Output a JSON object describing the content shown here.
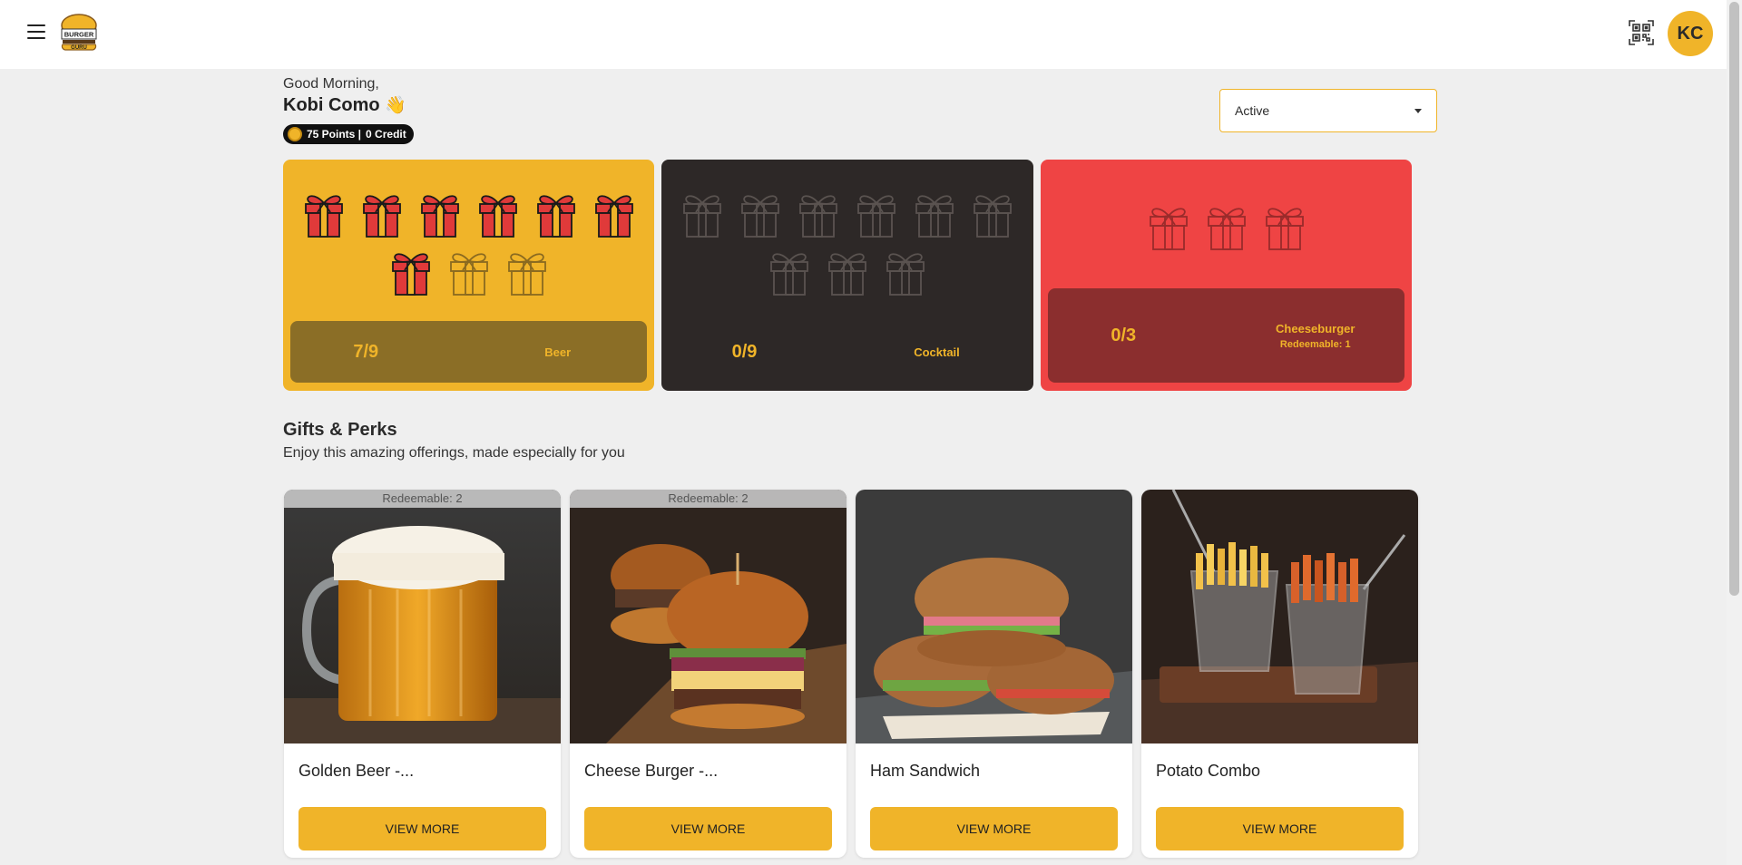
{
  "header": {
    "logo_text": "THE BURGER GURU",
    "avatar_initials": "KC"
  },
  "greeting": {
    "salutation": "Good Morning,",
    "name": "Kobi Como",
    "wave": "👋",
    "points": "75 Points |",
    "credit": "0 Credit"
  },
  "filter": {
    "selected": "Active"
  },
  "stamp_cards": [
    {
      "count": "7/9",
      "reward": "Beer",
      "filled": 7,
      "total": 9,
      "color": "#f0b429"
    },
    {
      "count": "0/9",
      "reward": "Cocktail",
      "filled": 0,
      "total": 9,
      "color": "#2d2827"
    },
    {
      "count": "0/3",
      "reward": "Cheeseburger",
      "redeemable": "Redeemable: 1",
      "filled": 0,
      "total": 3,
      "color": "#ef4444"
    }
  ],
  "perks": {
    "title": "Gifts & Perks",
    "subtitle": "Enjoy this amazing offerings, made especially for you",
    "items": [
      {
        "name": "Golden Beer -...",
        "ribbon": "Redeemable: 2",
        "button": "VIEW MORE"
      },
      {
        "name": "Cheese Burger -...",
        "ribbon": "Redeemable: 2",
        "button": "VIEW MORE"
      },
      {
        "name": "Ham Sandwich",
        "ribbon": "",
        "button": "VIEW MORE"
      },
      {
        "name": "Potato Combo",
        "ribbon": "",
        "button": "VIEW MORE"
      }
    ]
  },
  "colors": {
    "accent": "#f0b429",
    "dark": "#2d2827",
    "red": "#ef4444"
  }
}
